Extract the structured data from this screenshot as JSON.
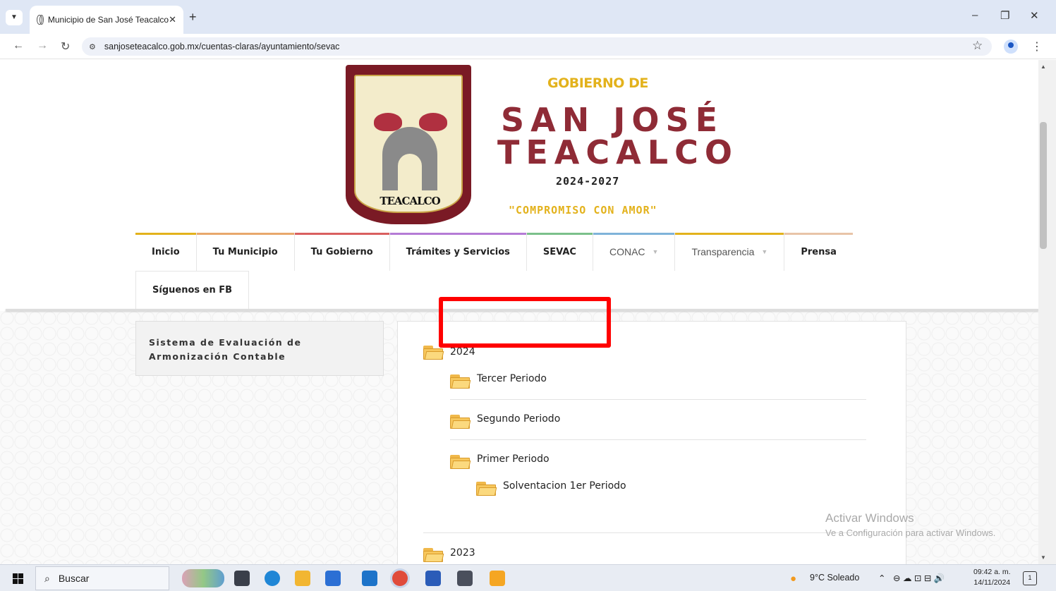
{
  "browser": {
    "tab_title": "Municipio de San José Teacalco",
    "tab_close": "✕",
    "new_tab": "+",
    "url": "sanjoseteacalco.gob.mx/cuentas-claras/ayuntamiento/sevac"
  },
  "header": {
    "logo_text": "TEACALCO",
    "gobierno_de": "GOBIERNO DE",
    "name_line1": "SAN JOSÉ",
    "name_line2": "TEACALCO",
    "years": "2024-2027",
    "motto": "\"COMPROMISO CON AMOR\""
  },
  "nav": {
    "items": [
      {
        "label": "Inicio",
        "color": "#e3b21c"
      },
      {
        "label": "Tu Municipio",
        "color": "#e8a86b"
      },
      {
        "label": "Tu Gobierno",
        "color": "#d95f5f"
      },
      {
        "label": "Trámites y Servicios",
        "color": "#b57bd6"
      },
      {
        "label": "SEVAC",
        "color": "#7bc08a"
      },
      {
        "label": "CONAC",
        "color": "#7fb3d9"
      },
      {
        "label": "Transparencia",
        "color": "#e3b21c"
      },
      {
        "label": "Prensa",
        "color": "#e8c4a8"
      }
    ],
    "second_row": {
      "label": "Síguenos en FB"
    },
    "dropdown_caret": "▼"
  },
  "sidebar": {
    "title": "Sistema de Evaluación de Armonización Contable"
  },
  "tree": {
    "year_2024": "2024",
    "tercer": "Tercer Periodo",
    "segundo": "Segundo Periodo",
    "primer": "Primer Periodo",
    "solventacion": "Solventacion 1er Periodo",
    "year_2023": "2023"
  },
  "watermark": {
    "title": "Activar Windows",
    "subtitle": "Ve a Configuración para activar Windows."
  },
  "taskbar": {
    "search_label": "Buscar",
    "weather": "9°C Soleado",
    "time": "09:42 a. m.",
    "date": "14/11/2024",
    "notifications": "1"
  }
}
